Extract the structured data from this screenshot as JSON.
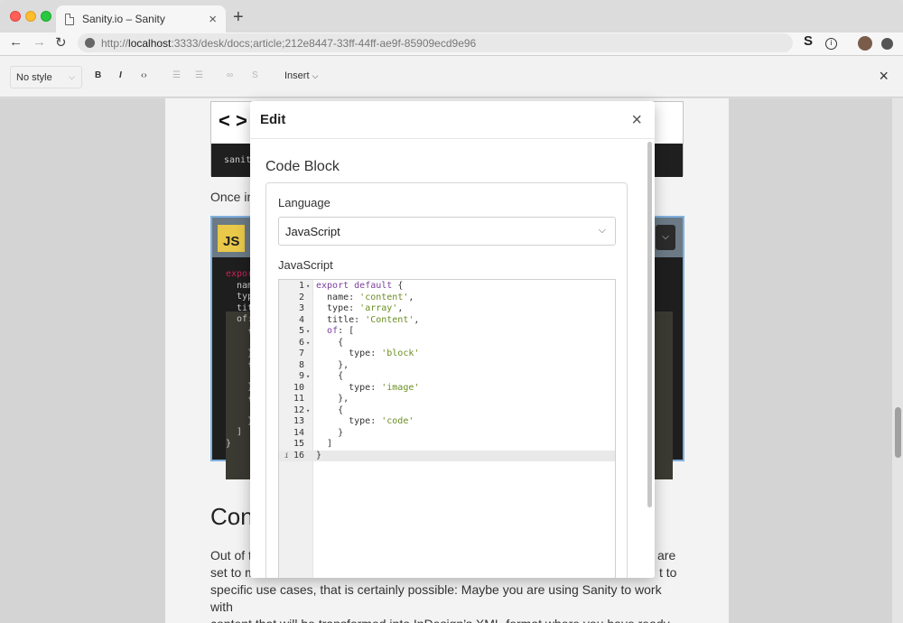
{
  "browser": {
    "tab_title": "Sanity.io – Sanity",
    "tab_close": "×",
    "new_tab": "+",
    "url_prefix": "http://",
    "url_host": "localhost",
    "url_rest": ":3333/desk/docs;article;212e8447-33ff-44ff-ae9f-85909ecd9e96",
    "ext_s": "S",
    "ext_info": "i"
  },
  "toolbar": {
    "style_value": "No style",
    "bold": "B",
    "italic": "I",
    "code": "‹›",
    "strike": "S",
    "insert_label": "Insert",
    "close": "×"
  },
  "document": {
    "code_header_glyph": "< >",
    "code_header_text": "sanit",
    "once_text": "Once in",
    "js_badge": "JS",
    "js_preview_lines": [
      "export",
      "  nam",
      "  typ",
      "  tit",
      "  of:",
      "    {",
      "",
      "    }",
      "    {",
      "",
      "    }",
      "    {",
      "",
      "    }",
      "  ]",
      "}"
    ],
    "heading": "Con",
    "paragraph_lines": [
      "Out of t",
      "set to m",
      "specific use cases, that is certainly possible: Maybe you are using Sanity to work with",
      "content that will be transformed into InDesign’s XML-format where you have ready-made"
    ],
    "paragraph_right_fragments": [
      "are",
      "t to"
    ]
  },
  "modal": {
    "title": "Edit",
    "close": "×",
    "section_title": "Code Block",
    "language_label": "Language",
    "language_value": "JavaScript",
    "code_label": "JavaScript",
    "code_lines": [
      {
        "n": "1",
        "fold": true,
        "text": "export default {"
      },
      {
        "n": "2",
        "fold": false,
        "text": "  name: 'content',"
      },
      {
        "n": "3",
        "fold": false,
        "text": "  type: 'array',"
      },
      {
        "n": "4",
        "fold": false,
        "text": "  title: 'Content',"
      },
      {
        "n": "5",
        "fold": true,
        "text": "  of: ["
      },
      {
        "n": "6",
        "fold": true,
        "text": "    {"
      },
      {
        "n": "7",
        "fold": false,
        "text": "      type: 'block'"
      },
      {
        "n": "8",
        "fold": false,
        "text": "    },"
      },
      {
        "n": "9",
        "fold": true,
        "text": "    {"
      },
      {
        "n": "10",
        "fold": false,
        "text": "      type: 'image'"
      },
      {
        "n": "11",
        "fold": false,
        "text": "    },"
      },
      {
        "n": "12",
        "fold": true,
        "text": "    {"
      },
      {
        "n": "13",
        "fold": false,
        "text": "      type: 'code'"
      },
      {
        "n": "14",
        "fold": false,
        "text": "    }"
      },
      {
        "n": "15",
        "fold": false,
        "text": "  ]"
      },
      {
        "n": "16",
        "fold": false,
        "active": true,
        "info": "i",
        "text": "}"
      }
    ]
  }
}
